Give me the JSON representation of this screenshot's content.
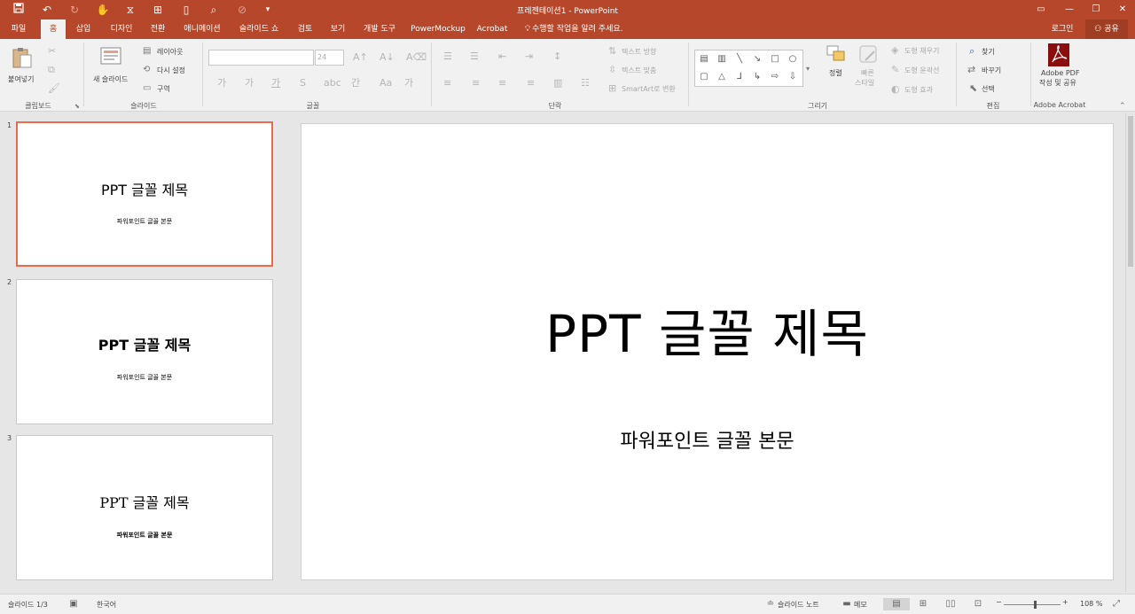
{
  "title_bar": {
    "title": "프레젠테이션1 - PowerPoint",
    "qat_icons": [
      "save-icon",
      "undo-icon",
      "redo-icon",
      "touch-mode-icon",
      "format-icon",
      "present-icon",
      "new-icon",
      "preview-icon",
      "disabled-icon",
      "customize-icon"
    ]
  },
  "tabs": [
    {
      "label": "파일"
    },
    {
      "label": "홈"
    },
    {
      "label": "삽입"
    },
    {
      "label": "디자인"
    },
    {
      "label": "전환"
    },
    {
      "label": "애니메이션"
    },
    {
      "label": "슬라이드 쇼"
    },
    {
      "label": "검토"
    },
    {
      "label": "보기"
    },
    {
      "label": "개발 도구"
    },
    {
      "label": "PowerMockup"
    },
    {
      "label": "Acrobat"
    }
  ],
  "tell_me": "수행할 작업을 알려 주세요.",
  "signin": "로그인",
  "share": "공유",
  "ribbon": {
    "clipboard": {
      "paste": "붙여넣기",
      "group": "클립보드"
    },
    "slides": {
      "new_slide": "새 슬라이드",
      "layout": "레이아웃",
      "reset": "다시 설정",
      "section": "구역",
      "group": "슬라이드"
    },
    "font": {
      "size": "24",
      "group": "글꼴"
    },
    "paragraph": {
      "text_direction": "텍스트 방향",
      "align_text": "텍스트 맞춤",
      "smartart": "SmartArt로 변환",
      "group": "단락"
    },
    "drawing": {
      "arrange": "정렬",
      "quick_styles": "빠른",
      "quick_styles2": "스타일",
      "shape_fill": "도형 채우기",
      "shape_outline": "도형 윤곽선",
      "shape_effects": "도형 효과",
      "group": "그리기"
    },
    "editing": {
      "find": "찾기",
      "replace": "바꾸기",
      "select": "선택",
      "group": "편집"
    },
    "acrobat": {
      "create1": "Adobe PDF",
      "create2": "작성 및 공유",
      "group": "Adobe Acrobat"
    }
  },
  "slides": [
    {
      "number": "1",
      "title": "PPT 글꼴 제목",
      "body": "파워포인트 글꼴 본문"
    },
    {
      "number": "2",
      "title": "PPT 글꼴 제목",
      "body": "파워포인트 글꼴 본문"
    },
    {
      "number": "3",
      "title": "PPT 글꼴 제목",
      "body": "파워포인트 글꼴 본문"
    }
  ],
  "main_slide": {
    "title": "PPT 글꼴 제목",
    "body": "파워포인트 글꼴 본문"
  },
  "status": {
    "slide_count": "슬라이드 1/3",
    "language": "한국어",
    "notes": "슬라이드 노트",
    "comments": "메모",
    "zoom": "108 %",
    "zoom_level": 0.54
  }
}
